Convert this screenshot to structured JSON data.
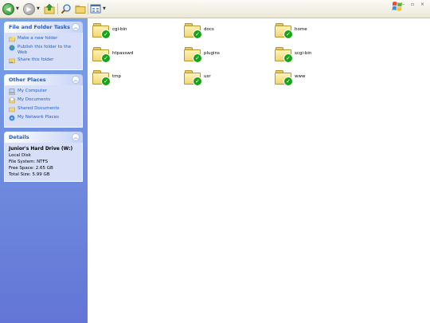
{
  "toolbar": {
    "items": [
      "back-icon",
      "forward-icon",
      "up-folder-icon",
      "search-icon",
      "folders-icon",
      "views-icon"
    ],
    "accent": "#2e8f2e"
  },
  "window_controls": "– ▫ ×",
  "taskpane": {
    "file_tasks": {
      "title": "File and Folder Tasks",
      "items": [
        "Make a new folder",
        "Publish this folder to the Web",
        "Share this folder"
      ]
    },
    "other_places": {
      "title": "Other Places",
      "items": [
        "My Computer",
        "My Documents",
        "Shared Documents",
        "My Network Places"
      ]
    },
    "details": {
      "title": "Details",
      "name": "Junior's Hard Drive (W:)",
      "type": "Local Disk",
      "file_system": "File System: NTFS",
      "free_space": "Free Space: 2.65 GB",
      "total_size": "Total Size: 5.99 GB"
    }
  },
  "folders": [
    "cgi-bin",
    "docs",
    "home",
    "htpasswd",
    "plugins",
    "scgi-bin",
    "tmp",
    "usr",
    "www"
  ],
  "colors": {
    "taskpane_top": "#7ba2e7",
    "taskpane_bottom": "#6375d6",
    "link": "#215dc6",
    "folder": "#f2d673",
    "check": "#19a319"
  }
}
